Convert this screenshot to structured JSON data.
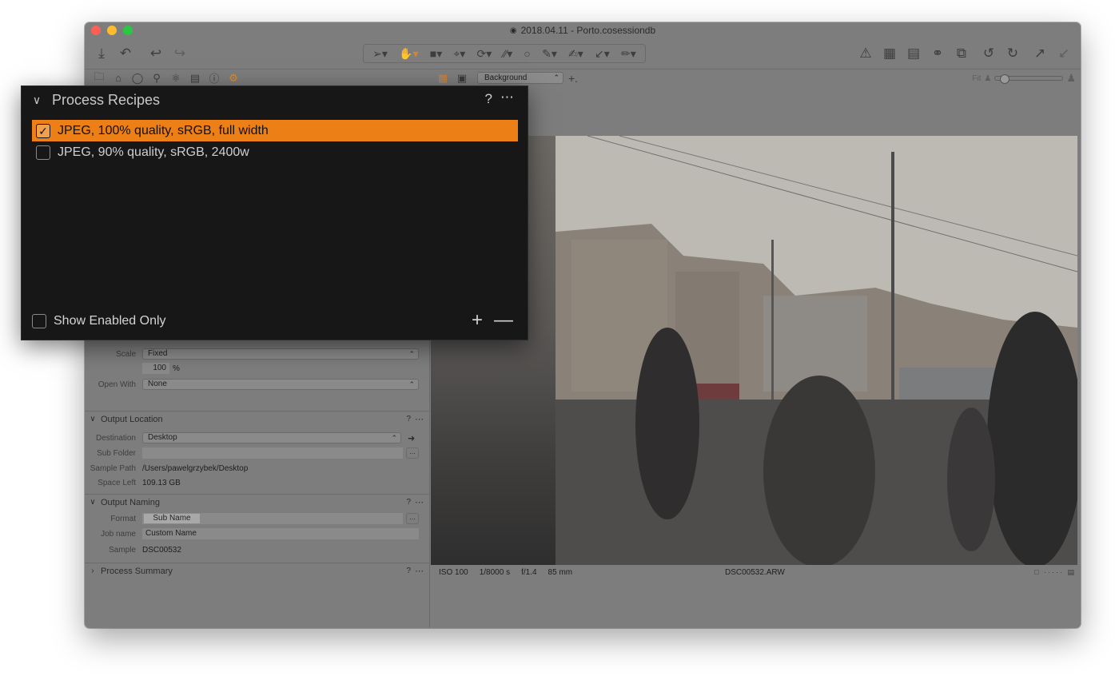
{
  "window": {
    "title": "2018.04.11 - Porto.cosessiondb"
  },
  "popup": {
    "title": "Process Recipes",
    "help": "?",
    "more": "⋯",
    "recipes": [
      {
        "label": "JPEG, 100% quality, sRGB, full width",
        "checked": true
      },
      {
        "label": "JPEG, 90% quality, sRGB, 2400w",
        "checked": false
      }
    ],
    "show_enabled_only": "Show Enabled Only",
    "add": "+",
    "remove": "—"
  },
  "basic": {
    "scale_label": "Scale",
    "scale_value": "Fixed",
    "scale_percent": "100",
    "percent_unit": "%",
    "open_with_label": "Open With",
    "open_with_value": "None"
  },
  "output_location": {
    "title": "Output Location",
    "help": "?",
    "more": "⋯",
    "destination_label": "Destination",
    "destination_value": "Desktop",
    "sub_folder_label": "Sub Folder",
    "sub_folder_value": "",
    "sample_path_label": "Sample Path",
    "sample_path_value": "/Users/pawelgrzybek/Desktop",
    "space_left_label": "Space Left",
    "space_left_value": "109.13 GB",
    "browse": "..."
  },
  "output_naming": {
    "title": "Output Naming",
    "help": "?",
    "more": "⋯",
    "format_label": "Format",
    "format_token": "Sub Name",
    "job_name_label": "Job name",
    "job_name_value": "Custom Name",
    "sample_label": "Sample",
    "sample_value": "DSC00532",
    "browse": "..."
  },
  "process_summary": {
    "title": "Process Summary",
    "help": "?",
    "more": "⋯"
  },
  "viewer": {
    "style_select": "Background",
    "fit_label": "Fit"
  },
  "status": {
    "iso": "ISO 100",
    "shutter": "1/8000 s",
    "aperture": "f/1.4",
    "focal": "85 mm",
    "filename": "DSC00532.ARW"
  },
  "colors": {
    "accent": "#ec7f16",
    "popup_bg": "#171717",
    "window_bg": "#7d7d7d"
  }
}
